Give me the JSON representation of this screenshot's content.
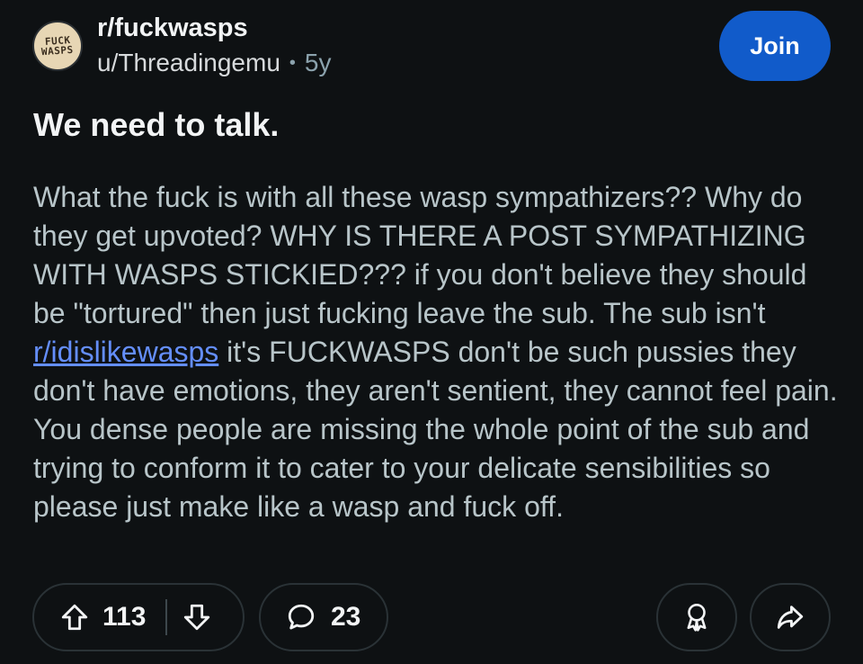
{
  "post": {
    "subreddit": "r/fuckwasps",
    "subreddit_icon_text": [
      "FUCK",
      "WASPS"
    ],
    "author": "u/Threadingemu",
    "separator": "•",
    "age": "5y",
    "join_label": "Join",
    "title": "We need to talk.",
    "body_before_link": "What the fuck is with all these wasp sympathizers?? Why do they get upvoted? WHY IS THERE A POST SYMPATHIZING WITH WASPS STICKIED??? if you don't believe they should be \"tortured\" then just fucking leave the sub. The sub isn't ",
    "body_link": "r/idislikewasps",
    "body_after_link": " it's FUCKWASPS don't be such pussies they don't have emotions, they aren't sentient, they cannot feel pain. You dense people are missing the whole point of the sub and trying to conform it to cater to your delicate sensibilities so please just make like a wasp and fuck off."
  },
  "actions": {
    "upvotes": "113",
    "comments": "23"
  },
  "icons": {
    "upvote": "upvote-arrow-icon",
    "downvote": "downvote-arrow-icon",
    "comment": "comment-bubble-icon",
    "award": "award-icon",
    "share": "share-arrow-icon"
  },
  "colors": {
    "background": "#0e1113",
    "join_button": "#115bca",
    "link": "#648efc",
    "body_text": "#b8c5c9"
  }
}
